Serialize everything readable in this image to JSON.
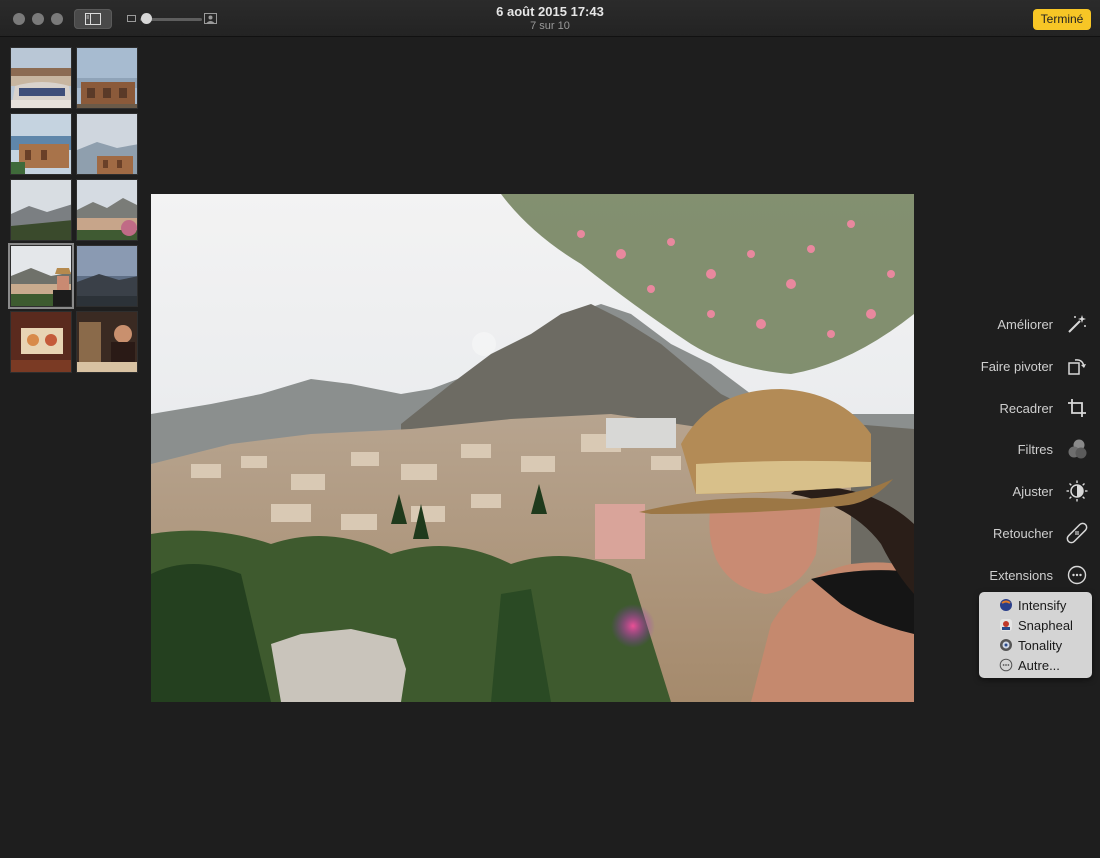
{
  "titlebar": {
    "date": "6 août 2015 17:43",
    "count": "7 sur 10",
    "done_label": "Terminé",
    "zoom_level": 0.1
  },
  "filmstrip": {
    "selected_index": 6,
    "thumbnails": [
      "theatre-1",
      "theatre-2",
      "coast-ruins",
      "ruins-sea",
      "mountains",
      "village",
      "woman-hat",
      "mountain-view",
      "dinner-table",
      "dinner-people"
    ]
  },
  "tools": {
    "enhance": "Améliorer",
    "rotate": "Faire pivoter",
    "crop": "Recadrer",
    "filters": "Filtres",
    "adjust": "Ajuster",
    "retouch": "Retoucher",
    "extensions": "Extensions"
  },
  "extensions_menu": {
    "items": [
      "Intensify",
      "Snapheal",
      "Tonality",
      "Autre..."
    ]
  },
  "colors": {
    "accent": "#f7c626",
    "background": "#1e1e1e"
  }
}
